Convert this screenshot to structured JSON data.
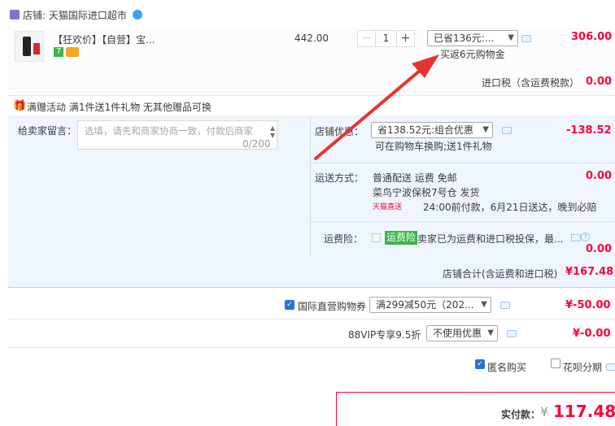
{
  "store": {
    "label": "店铺: 天猫国际进口超市"
  },
  "item": {
    "title": "【狂欢价】【自营】宝...",
    "tag_text": "7",
    "unit_price": "442.00",
    "quantity": "1",
    "minus": "−",
    "plus": "+",
    "discount_select": "已省136元:...",
    "coupon_note": "买返6元购物金",
    "total": "306.00"
  },
  "tax": {
    "label": "进口税（含运费税款）",
    "value": "0.00"
  },
  "gift": {
    "icon": "🎁",
    "text": "满赠活动   满1件送1件礼物 无其他赠品可换"
  },
  "message": {
    "label": "给卖家留言：",
    "placeholder": "选填，请先和商家协商一致，付款后商家",
    "count": "0/200"
  },
  "shop_discount": {
    "label": "店铺优惠：",
    "select": "省138.52元:组合优惠",
    "value": "-138.52",
    "note": "可在购物车换购;送1件礼物"
  },
  "shipping": {
    "label": "运送方式：",
    "line1": "普通配送 运费 免邮",
    "value": "0.00",
    "line2": "菜鸟宁波保税7号仓  发货",
    "tag": "天猫直送",
    "line3": "24:00前付款，6月21日送达，晚到必赔"
  },
  "insurance": {
    "label": "运费险：",
    "badge": "运费险",
    "text": "卖家已为运费和进口税投保，最...",
    "help": "?",
    "value": "0.00"
  },
  "shop_total": {
    "label": "店铺合计(含运费和进口税)",
    "value": "¥167.48"
  },
  "intl_coupon": {
    "label": "国际直营购物券",
    "select": "满299减50元（202...",
    "value": "¥-50.00"
  },
  "vip": {
    "label": "88VIP专享9.5折",
    "select": "不使用优惠",
    "value": "¥-0.00"
  },
  "options": {
    "anonymous": "匿名购买",
    "huabei": "花呗分期"
  },
  "payment": {
    "label": "实付款：",
    "currency": "¥",
    "value": "117.48"
  },
  "colors": {
    "price_red": "#ff0036",
    "panel_blue": "#eff5fd",
    "arrow_red": "#e8322f"
  }
}
